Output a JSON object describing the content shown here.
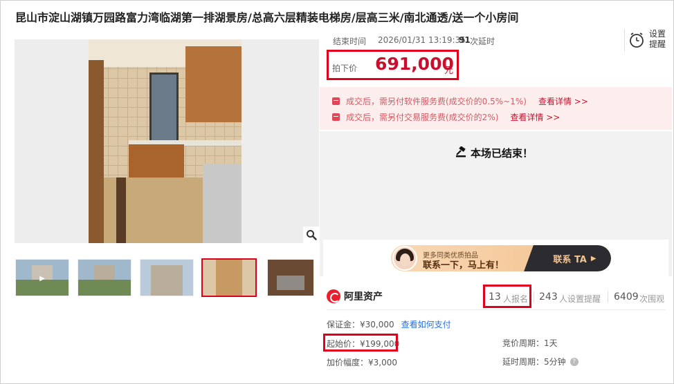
{
  "title": "昆山市淀山湖镇万园路富力湾临湖第一排湖景房/总高六层精装电梯房/层高三米/南北通透/送一个小房间",
  "auction": {
    "end_label": "结束时间",
    "end_time": "2026/01/31 13:19:35",
    "delay_count": "91",
    "delay_label": "次延时",
    "remind_label": "设置提醒",
    "price_label": "拍下价",
    "price_value": "691,000",
    "price_unit": "元"
  },
  "fees": [
    {
      "text": "成交后，需另付软件服务费(成交价的0.5%~1%)",
      "link": "查看详情 >>"
    },
    {
      "text": "成交后，需另付交易服务费(成交价的2%)",
      "link": "查看详情 >>"
    }
  ],
  "status": {
    "ended_text": "本场已结束！"
  },
  "banner": {
    "subtitle": "更多同类优质拍品",
    "headline": "联系一下，马上有！",
    "cta": "联系 TA"
  },
  "brand": {
    "name": "阿里资产"
  },
  "stats": {
    "signup_count": "13",
    "signup_label": "人报名",
    "remind_count": "243",
    "remind_label": "人设置提醒",
    "view_count": "6409",
    "view_label": "次围观"
  },
  "details": {
    "deposit": "保证金：¥30,000",
    "deposit_link": "查看如何支付",
    "start_price": "起始价：¥199,000",
    "increment": "加价幅度：¥3,000",
    "bid_cycle": "竞价周期：1天",
    "extension": "延时周期：5分钟"
  },
  "icons": {
    "zoom": "magnifier-icon",
    "remind": "alarm-clock-icon",
    "ended": "gavel-icon",
    "fee": "fee-tag-icon",
    "help": "question-icon",
    "play": "play-icon"
  },
  "colors": {
    "accent_red": "#c8102e",
    "highlight_border": "#e1001b",
    "link_blue": "#2a6fdb",
    "fee_bg": "#fdeeee"
  }
}
